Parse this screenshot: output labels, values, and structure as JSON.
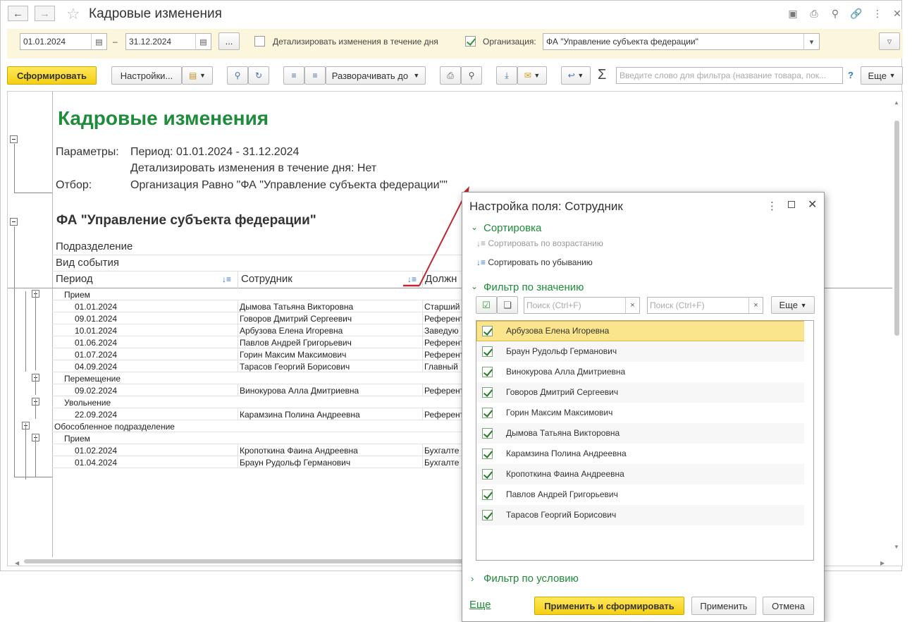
{
  "window": {
    "title": "Кадровые изменения"
  },
  "params": {
    "date_from": "01.01.2024",
    "date_sep": "–",
    "date_to": "31.12.2024",
    "more_dots": "...",
    "detail_label": "Детализировать изменения в течение дня",
    "org_label": "Организация:",
    "org_value": "ФА \"Управление субъекта федерации\""
  },
  "toolbar": {
    "form_button": "Сформировать",
    "settings_button": "Настройки...",
    "expand_button": "Разворачивать до",
    "sigma": "Σ",
    "filter_placeholder": "Введите слово для фильтра (название товара, пок...",
    "help": "?",
    "more_button": "Еще"
  },
  "report": {
    "title": "Кадровые изменения",
    "params_label": "Параметры:",
    "period_text": "Период: 01.01.2024 - 31.12.2024",
    "detail_text": "Детализировать изменения в течение дня: Нет",
    "filter_label": "Отбор:",
    "filter_text": "Организация Равно \"ФА \"Управление субъекта федерации\"\"",
    "org_heading": "ФА \"Управление субъекта федерации\"",
    "header_dept": "Подразделение",
    "header_event": "Вид события",
    "header_period": "Период",
    "header_employee": "Сотрудник",
    "header_position": "Должн"
  },
  "rows": [
    {
      "kind": "group",
      "text": "Прием"
    },
    {
      "kind": "data",
      "date": "01.01.2024",
      "emp": "Дымова Татьяна Викторовна",
      "pos": "Старший"
    },
    {
      "kind": "data",
      "date": "09.01.2024",
      "emp": "Говоров Дмитрий Сергеевич",
      "pos": "Референт"
    },
    {
      "kind": "data",
      "date": "10.01.2024",
      "emp": "Арбузова Елена Игоревна",
      "pos": "Заведую"
    },
    {
      "kind": "data",
      "date": "01.06.2024",
      "emp": "Павлов Андрей Григорьевич",
      "pos": "Референт"
    },
    {
      "kind": "data",
      "date": "01.07.2024",
      "emp": "Горин Максим Максимович",
      "pos": "Референт"
    },
    {
      "kind": "data",
      "date": "04.09.2024",
      "emp": "Тарасов Георгий Борисович",
      "pos": "Главный"
    },
    {
      "kind": "group",
      "text": "Перемещение"
    },
    {
      "kind": "data",
      "date": "09.02.2024",
      "emp": "Винокурова Алла Дмитриевна",
      "pos": "Референт"
    },
    {
      "kind": "group",
      "text": "Увольнение"
    },
    {
      "kind": "data",
      "date": "22.09.2024",
      "emp": "Карамзина Полина Андреевна",
      "pos": "Референт"
    },
    {
      "kind": "dept",
      "text": "Обособленное подразделение"
    },
    {
      "kind": "group",
      "text": "Прием"
    },
    {
      "kind": "data",
      "date": "01.02.2024",
      "emp": "Кропоткина Фаина Андреевна",
      "pos": "Бухгалте"
    },
    {
      "kind": "data",
      "date": "01.04.2024",
      "emp": "Браун Рудольф Германович",
      "pos": "Бухгалте"
    }
  ],
  "dialog": {
    "title": "Настройка поля: Сотрудник",
    "sort_section": "Сортировка",
    "sort_asc": "Сортировать по возрастанию",
    "sort_desc": "Сортировать по убыванию",
    "value_filter_section": "Фильтр по значению",
    "search_placeholder_1": "Поиск (Ctrl+F)",
    "search_placeholder_2": "Поиск (Ctrl+F)",
    "more_button": "Еще",
    "items": [
      "Арбузова Елена Игоревна",
      "Браун Рудольф Германович",
      "Винокурова Алла Дмитриевна",
      "Говоров Дмитрий Сергеевич",
      "Горин Максим Максимович",
      "Дымова Татьяна Викторовна",
      "Карамзина Полина Андреевна",
      "Кропоткина Фаина Андреевна",
      "Павлов Андрей Григорьевич",
      "Тарасов Георгий Борисович"
    ],
    "condition_filter_section": "Фильтр по условию",
    "more_link": "Еще",
    "apply_form_button": "Применить и сформировать",
    "apply_button": "Применить",
    "cancel_button": "Отмена"
  },
  "colors": {
    "accent_green": "#1e8c3a",
    "highlight_yellow": "#fbe58c",
    "params_bg": "#fbf6dc",
    "arrow_red": "#c0282d"
  }
}
